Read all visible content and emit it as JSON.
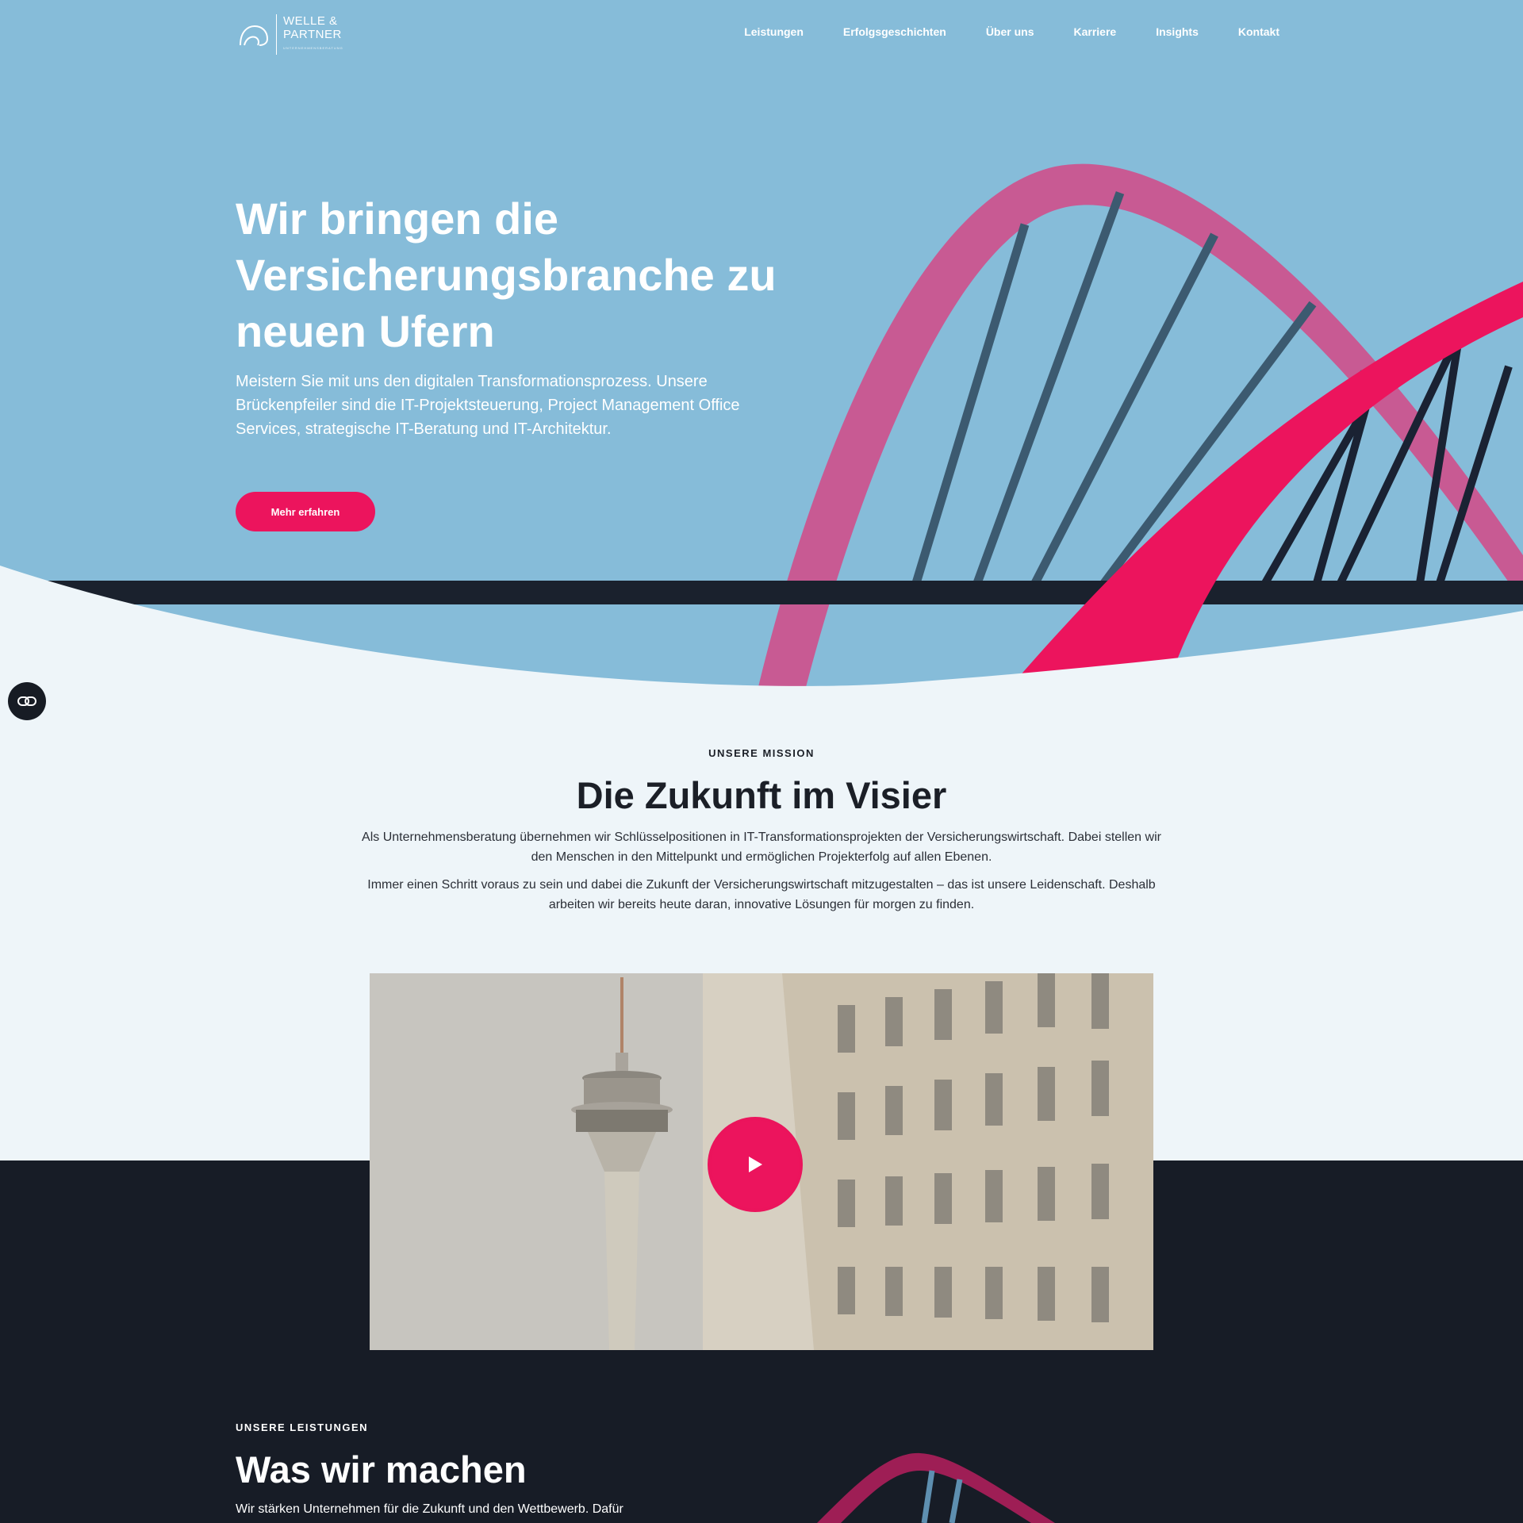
{
  "brand": {
    "line1": "WELLE &",
    "line2": "PARTNER",
    "tagline": "UNTERNEHMENSBERATUNG"
  },
  "nav": [
    "Leistungen",
    "Erfolgsgeschichten",
    "Über uns",
    "Karriere",
    "Insights",
    "Kontakt"
  ],
  "hero": {
    "title": "Wir bringen die Versicherungsbranche zu neuen Ufern",
    "subtitle": "Meistern Sie mit uns den digitalen Transformationsprozess. Unsere Brückenpfeiler sind die IT-Projektsteuerung, Project Management Office Services, strategische IT-Beratung und IT-Architektur.",
    "cta": "Mehr erfahren"
  },
  "mission": {
    "kicker": "UNSERE MISSION",
    "title": "Die Zukunft im Visier",
    "p1": "Als Unternehmensberatung übernehmen wir Schlüsselpositionen in IT-Transformationsprojekten der Versicherungswirtschaft. Dabei stellen wir den Menschen in den Mittelpunkt und ermöglichen Projekterfolg auf allen Ebenen.",
    "p2": "Immer einen Schritt voraus zu sein und dabei die Zukunft der Versicherungswirtschaft mitzugestalten – das ist unsere Leidenschaft. Deshalb arbeiten wir bereits heute daran, innovative Lösungen für morgen zu finden."
  },
  "services": {
    "kicker": "UNSERE LEISTUNGEN",
    "title": "Was wir machen",
    "text": "Wir stärken Unternehmen für die Zukunft und den Wettbewerb. Dafür"
  },
  "icons": {
    "play": "play-icon",
    "floating": "link-icon",
    "logo": "wave-logo-icon"
  },
  "colors": {
    "accent": "#ec145d",
    "sky": "#86bcd9",
    "dark": "#171c26",
    "arch": "#c85a93"
  }
}
